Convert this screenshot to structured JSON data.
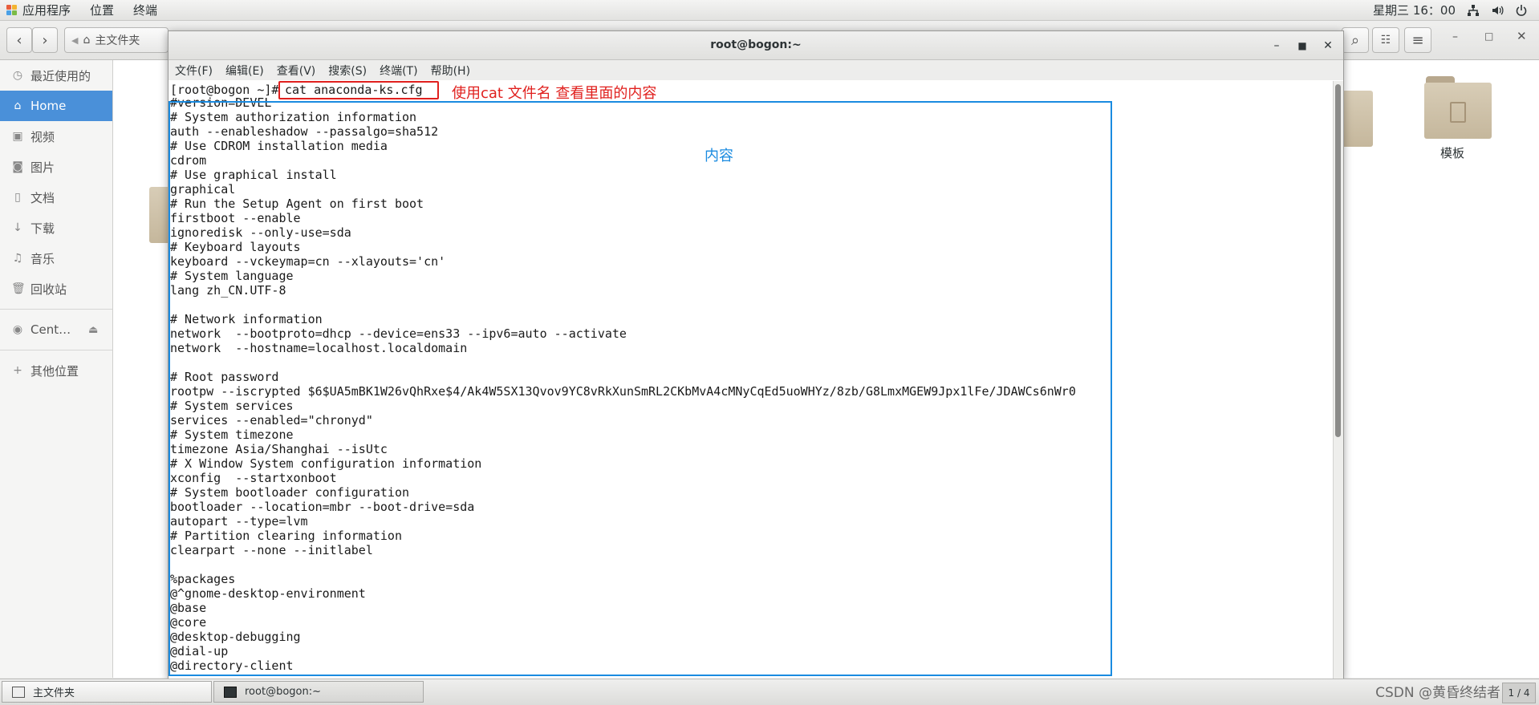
{
  "top_panel": {
    "applications": "应用程序",
    "places": "位置",
    "terminal": "终端",
    "clock": "星期三 16：00",
    "icons": [
      "network-icon",
      "volume-icon",
      "power-icon"
    ]
  },
  "file_manager": {
    "location": "主文件夹",
    "sidebar": {
      "recent": "最近使用的",
      "home": "Home",
      "videos": "视频",
      "pictures": "图片",
      "documents": "文档",
      "downloads": "下载",
      "music": "音乐",
      "trash": "回收站",
      "device": "Cent…",
      "other": "其他位置"
    },
    "folder_label": "模板"
  },
  "terminal": {
    "title": "root@bogon:~",
    "menu": [
      "文件(F)",
      "编辑(E)",
      "查看(V)",
      "搜索(S)",
      "终端(T)",
      "帮助(H)"
    ],
    "prompt": "[root@bogon ~]#",
    "command": "cat anaconda-ks.cfg",
    "lines": [
      "#version=DEVEL",
      "# System authorization information",
      "auth --enableshadow --passalgo=sha512",
      "# Use CDROM installation media",
      "cdrom",
      "# Use graphical install",
      "graphical",
      "# Run the Setup Agent on first boot",
      "firstboot --enable",
      "ignoredisk --only-use=sda",
      "# Keyboard layouts",
      "keyboard --vckeymap=cn --xlayouts='cn'",
      "# System language",
      "lang zh_CN.UTF-8",
      "",
      "# Network information",
      "network  --bootproto=dhcp --device=ens33 --ipv6=auto --activate",
      "network  --hostname=localhost.localdomain",
      "",
      "# Root password",
      "rootpw --iscrypted $6$UA5mBK1W26vQhRxe$4/Ak4W5SX13Qvov9YC8vRkXunSmRL2CKbMvA4cMNyCqEd5uoWHYz/8zb/G8LmxMGEW9Jpx1lFe/JDAWCs6nWr0",
      "# System services",
      "services --enabled=\"chronyd\"",
      "# System timezone",
      "timezone Asia/Shanghai --isUtc",
      "# X Window System configuration information",
      "xconfig  --startxonboot",
      "# System bootloader configuration",
      "bootloader --location=mbr --boot-drive=sda",
      "autopart --type=lvm",
      "# Partition clearing information",
      "clearpart --none --initlabel",
      "",
      "%packages",
      "@^gnome-desktop-environment",
      "@base",
      "@core",
      "@desktop-debugging",
      "@dial-up",
      "@directory-client"
    ]
  },
  "annotations": {
    "command_note": "使用cat 文件名 查看里面的内容",
    "content_note": "内容",
    "command_color": "#e0201e",
    "content_color": "#1a8be0"
  },
  "taskbar": {
    "task1": "主文件夹",
    "task2": "root@bogon:~",
    "watermark": "CSDN @黄昏终结者",
    "workspace": "1 / 4"
  }
}
